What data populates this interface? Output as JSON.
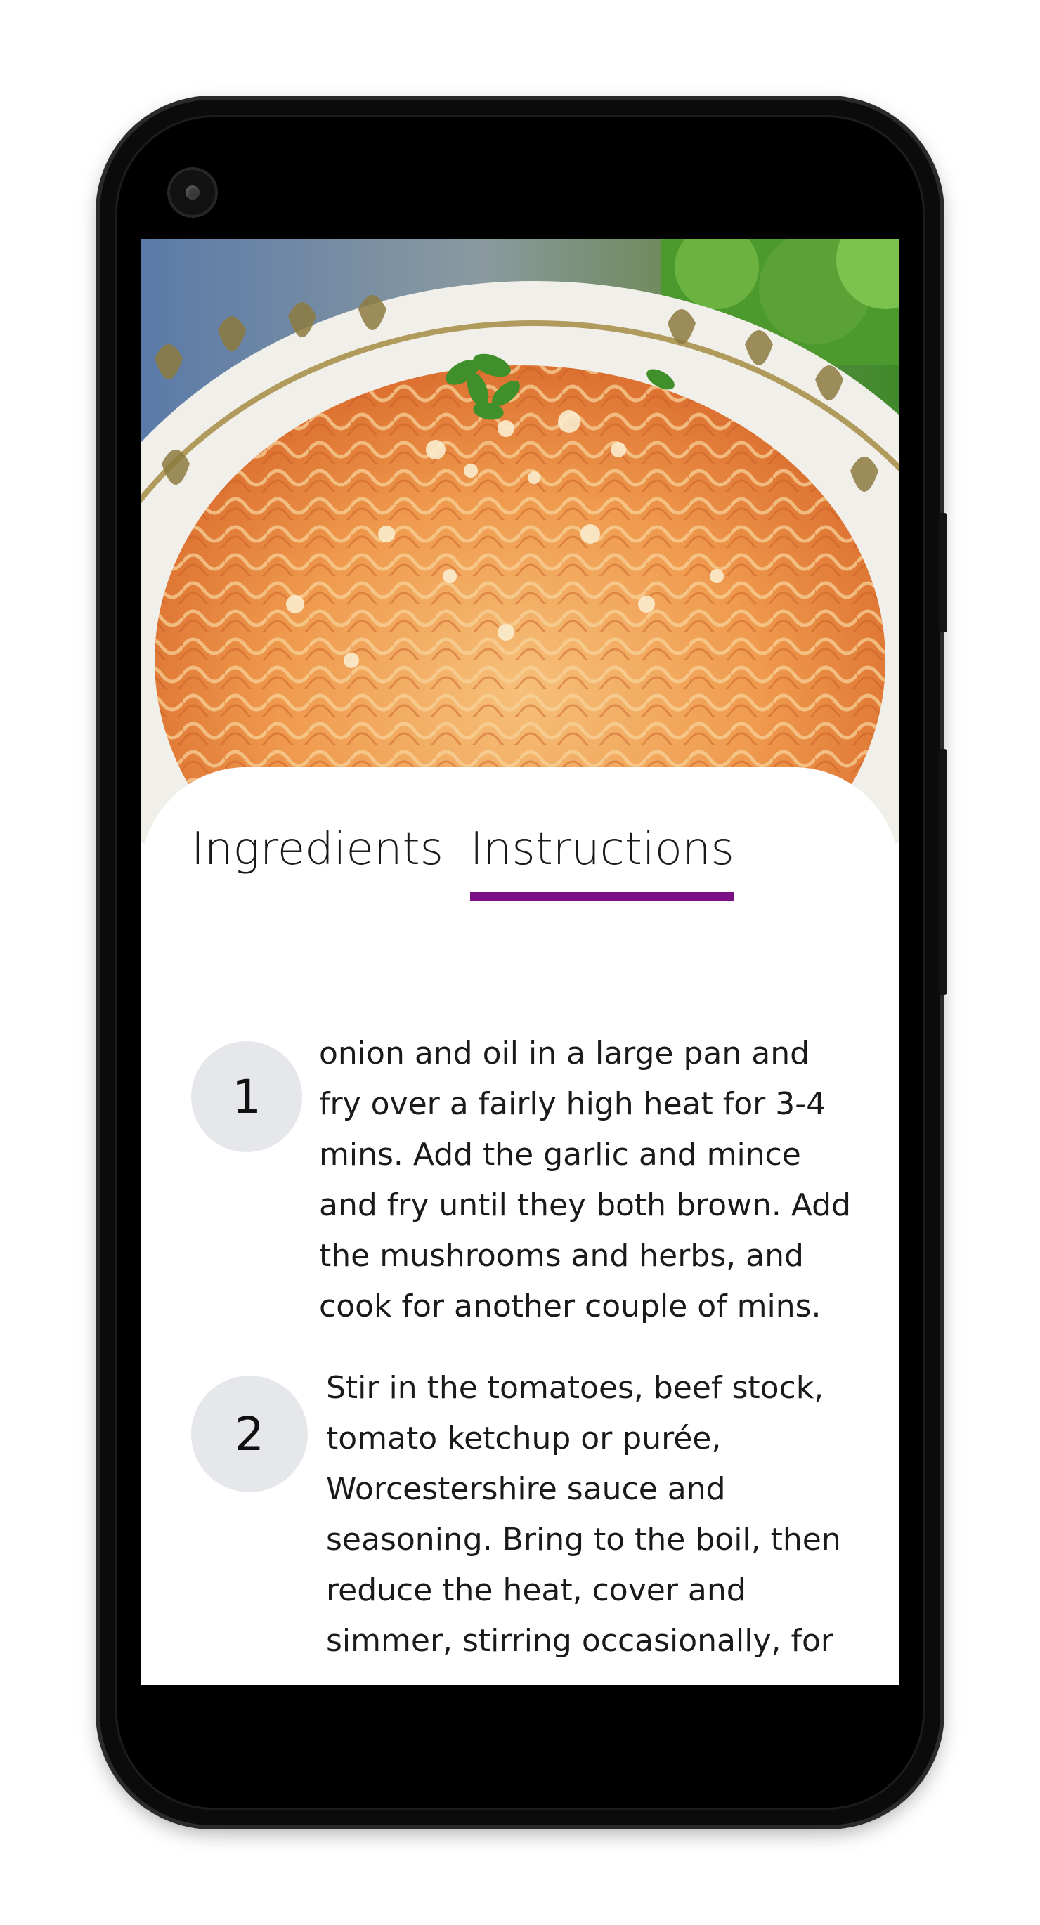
{
  "tabs": {
    "ingredients": "Ingredients",
    "instructions": "Instructions",
    "active": "Instructions",
    "accent_color": "#7a0f86"
  },
  "steps": [
    {
      "number": "1",
      "text": "onion and oil in a large pan and fry over a fairly high heat for 3-4 mins. Add the garlic and mince and fry until they both brown. Add the mushrooms and herbs, and cook for another couple of mins."
    },
    {
      "number": "2",
      "text": "Stir in the tomatoes, beef stock, tomato ketchup or purée, Worcestershire sauce and seasoning. Bring to the boil, then reduce the heat, cover and simmer, stirring occasionally, for"
    }
  ],
  "hero": {
    "icon": "spaghetti-dish-image"
  }
}
